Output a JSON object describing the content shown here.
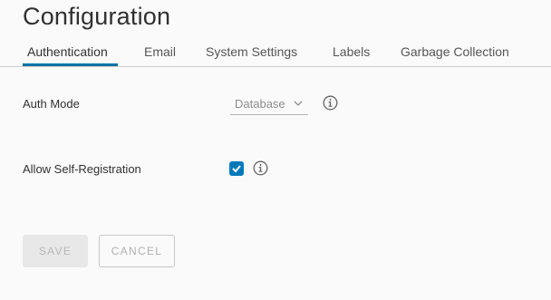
{
  "page": {
    "title": "Configuration"
  },
  "tabs": [
    {
      "label": "Authentication",
      "active": true
    },
    {
      "label": "Email",
      "active": false
    },
    {
      "label": "System Settings",
      "active": false
    },
    {
      "label": "Labels",
      "active": false
    },
    {
      "label": "Garbage Collection",
      "active": false
    }
  ],
  "form": {
    "auth_mode": {
      "label": "Auth Mode",
      "value": "Database",
      "icon": "chevron-down-icon",
      "info_icon": "info-icon"
    },
    "self_registration": {
      "label": "Allow Self-Registration",
      "checked": true,
      "info_icon": "info-icon"
    }
  },
  "actions": {
    "save_label": "SAVE",
    "save_enabled": false,
    "cancel_label": "CANCEL"
  },
  "colors": {
    "accent": "#0072a3",
    "checkbox": "#0079b8",
    "background": "#fafafa"
  }
}
